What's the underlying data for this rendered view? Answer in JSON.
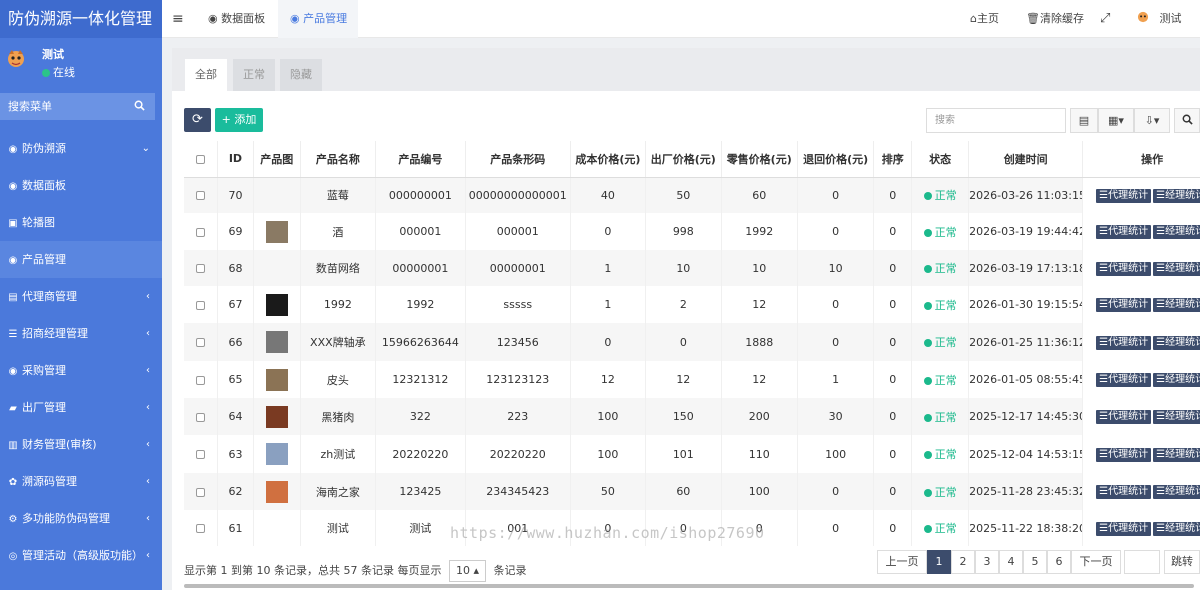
{
  "app": {
    "title": "防伪溯源一体化管理"
  },
  "user": {
    "name": "测试",
    "status": "在线"
  },
  "search": {
    "placeholder": "搜索菜单"
  },
  "menu": [
    {
      "label": "防伪溯源",
      "icon": "globe-icon",
      "arrow": "⌄",
      "active": false
    },
    {
      "label": "数据面板",
      "icon": "globe-icon",
      "arrow": "",
      "active": false
    },
    {
      "label": "轮播图",
      "icon": "image-icon",
      "arrow": "",
      "active": false
    },
    {
      "label": "产品管理",
      "icon": "globe-icon",
      "arrow": "",
      "active": true
    },
    {
      "label": "代理商管理",
      "icon": "id-card-icon",
      "arrow": "‹",
      "active": false
    },
    {
      "label": "招商经理管理",
      "icon": "list-icon",
      "arrow": "‹",
      "active": false
    },
    {
      "label": "采购管理",
      "icon": "globe-icon",
      "arrow": "‹",
      "active": false
    },
    {
      "label": "出厂管理",
      "icon": "truck-icon",
      "arrow": "‹",
      "active": false
    },
    {
      "label": "财务管理(审核)",
      "icon": "wallet-icon",
      "arrow": "‹",
      "active": false
    },
    {
      "label": "溯源码管理",
      "icon": "share-icon",
      "arrow": "‹",
      "active": false
    },
    {
      "label": "多功能防伪码管理",
      "icon": "gear-icon",
      "arrow": "‹",
      "active": false
    },
    {
      "label": "管理活动（高级版功能）",
      "icon": "circle-icon",
      "arrow": "‹",
      "active": false
    }
  ],
  "topbar": {
    "menu_toggle": "≡",
    "tab_dashboard": "数据面板",
    "tab_products": "产品管理",
    "home": "主页",
    "clear_cache": "清除缓存",
    "fullscreen": "⤢",
    "user": "测试"
  },
  "tabs": {
    "all": "全部",
    "normal": "正常",
    "hidden": "隐藏"
  },
  "toolbar": {
    "refresh": "⟳",
    "add": "添加",
    "search_placeholder": "搜索"
  },
  "table": {
    "headers": [
      "ID",
      "产品图",
      "产品名称",
      "产品编号",
      "产品条形码",
      "成本价格(元)",
      "出厂价格(元)",
      "零售价格(元)",
      "退回价格(元)",
      "排序",
      "状态",
      "创建时间",
      "操作"
    ],
    "op_agent": "代理统计",
    "op_manager": "经理统计",
    "rows": [
      {
        "id": "70",
        "thumb": "",
        "name": "蓝莓",
        "code": "000000001",
        "barcode": "00000000000001",
        "cost": "40",
        "factory": "50",
        "retail": "60",
        "refund": "0",
        "sort": "0",
        "status": "正常",
        "created": "2026-03-26 11:03:15"
      },
      {
        "id": "69",
        "thumb": "#8a7a64",
        "name": "酒",
        "code": "000001",
        "barcode": "000001",
        "cost": "0",
        "factory": "998",
        "retail": "1992",
        "refund": "0",
        "sort": "0",
        "status": "正常",
        "created": "2026-03-19 19:44:42"
      },
      {
        "id": "68",
        "thumb": "",
        "name": "数苗网络",
        "code": "00000001",
        "barcode": "00000001",
        "cost": "1",
        "factory": "10",
        "retail": "10",
        "refund": "10",
        "sort": "0",
        "status": "正常",
        "created": "2026-03-19 17:13:18"
      },
      {
        "id": "67",
        "thumb": "#1a1a1a",
        "name": "1992",
        "code": "1992",
        "barcode": "sssss",
        "cost": "1",
        "factory": "2",
        "retail": "12",
        "refund": "0",
        "sort": "0",
        "status": "正常",
        "created": "2026-01-30 19:15:54"
      },
      {
        "id": "66",
        "thumb": "#777777",
        "name": "XXX牌轴承",
        "code": "15966263644",
        "barcode": "123456",
        "cost": "0",
        "factory": "0",
        "retail": "1888",
        "refund": "0",
        "sort": "0",
        "status": "正常",
        "created": "2026-01-25 11:36:12"
      },
      {
        "id": "65",
        "thumb": "#8b7355",
        "name": "皮头",
        "code": "12321312",
        "barcode": "123123123",
        "cost": "12",
        "factory": "12",
        "retail": "12",
        "refund": "1",
        "sort": "0",
        "status": "正常",
        "created": "2026-01-05 08:55:45"
      },
      {
        "id": "64",
        "thumb": "#7a3a22",
        "name": "黑猪肉",
        "code": "322",
        "barcode": "223",
        "cost": "100",
        "factory": "150",
        "retail": "200",
        "refund": "30",
        "sort": "0",
        "status": "正常",
        "created": "2025-12-17 14:45:30"
      },
      {
        "id": "63",
        "thumb": "#8aa0c0",
        "name": "zh测试",
        "code": "20220220",
        "barcode": "20220220",
        "cost": "100",
        "factory": "101",
        "retail": "110",
        "refund": "100",
        "sort": "0",
        "status": "正常",
        "created": "2025-12-04 14:53:15"
      },
      {
        "id": "62",
        "thumb": "#d07040",
        "name": "海南之家",
        "code": "123425",
        "barcode": "234345423",
        "cost": "50",
        "factory": "60",
        "retail": "100",
        "refund": "0",
        "sort": "0",
        "status": "正常",
        "created": "2025-11-28 23:45:32"
      },
      {
        "id": "61",
        "thumb": "",
        "name": "测试",
        "code": "测试",
        "barcode": "001",
        "cost": "0",
        "factory": "0",
        "retail": "0",
        "refund": "0",
        "sort": "0",
        "status": "正常",
        "created": "2025-11-22 18:38:20"
      }
    ]
  },
  "pagination": {
    "info_prefix": "显示第 1 到第 10 条记录，总共 57 条记录 每页显示",
    "page_size": "10",
    "info_suffix": "条记录",
    "prev": "上一页",
    "pages": [
      "1",
      "2",
      "3",
      "4",
      "5",
      "6"
    ],
    "next": "下一页",
    "jump": "跳转"
  },
  "watermark": "https://www.huzhan.com/ishop27690",
  "colors": {
    "sidebar": "#4b79db",
    "accent": "#4a7be0",
    "status": "#1bb98c",
    "op_button": "#3c4c6c",
    "add_button": "#1abc9c"
  }
}
